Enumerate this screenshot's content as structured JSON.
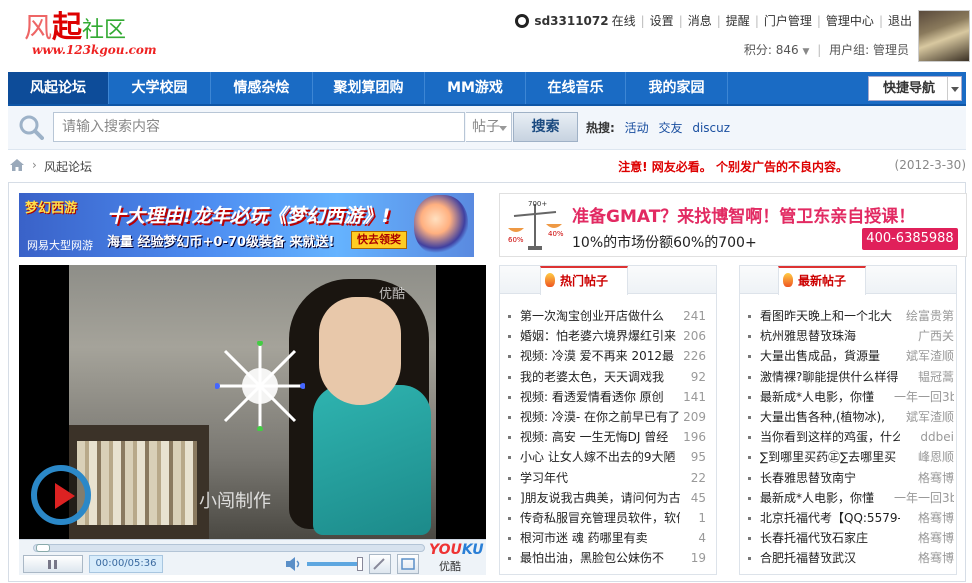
{
  "logo": {
    "part1": "风",
    "part2": "起",
    "part3": "社区",
    "url_text": "www.123kgou.com"
  },
  "user": {
    "username": "sd3311072",
    "status": "在线",
    "links": [
      "设置",
      "消息",
      "提醒",
      "门户管理",
      "管理中心",
      "退出"
    ],
    "points_label": "积分: 846",
    "group_label": "用户组: 管理员"
  },
  "nav": {
    "items": [
      "风起论坛",
      "大学校园",
      "情感杂烩",
      "聚划算团购",
      "MM游戏",
      "在线音乐",
      "我的家园"
    ],
    "active_index": 0,
    "quick_nav": "快捷导航"
  },
  "search": {
    "placeholder": "请输入搜索内容",
    "type_selected": "帖子",
    "button": "搜索",
    "hot_label": "热搜:",
    "hot_links": [
      "活动",
      "交友",
      "discuz"
    ]
  },
  "breadcrumb": {
    "current": "风起论坛",
    "notice": "注意! 网友必看。 个别发广告的不良内容。",
    "date": "(2012-3-30)"
  },
  "ad_left": {
    "game_logo": "梦幻西游",
    "game_sub": "网易大型网游",
    "headline": "十大理由!龙年必玩《梦幻西游》!",
    "subline": "海量 经验梦幻币+0-70级装备 来就送!",
    "button": "快去领奖"
  },
  "ad_right": {
    "headline": "准备GMAT？来找博智啊！管卫东亲自授课！",
    "subline": "10%的市场份额60%的700+",
    "phone": "400-6385988",
    "scale_top": "700+",
    "scale_left": "60%",
    "scale_right": "40%"
  },
  "video": {
    "watermark_top": "优酷",
    "watermark_bottom": "小闯制作",
    "time": "00:00/05:36",
    "progress": 0.0,
    "volume": 0.8,
    "brand_a": "YOU",
    "brand_b": "KU",
    "brand_cn": "优酷"
  },
  "hot_posts": {
    "title": "热门帖子",
    "items": [
      {
        "t": "第一次淘宝创业开店做什么",
        "n": "241"
      },
      {
        "t": "婚姻：怕老婆六境界爆红引来",
        "n": "206"
      },
      {
        "t": "视频: 冷漠 爱不再来 2012最",
        "n": "226"
      },
      {
        "t": "我的老婆太色，天天调戏我",
        "n": "92"
      },
      {
        "t": "视频: 看透爱情看透你 原创",
        "n": "141"
      },
      {
        "t": "视频: 冷漠- 在你之前早已有了",
        "n": "209"
      },
      {
        "t": "视频: 高安 一生无悔DJ 曾经",
        "n": "196"
      },
      {
        "t": "小心 让女人嫁不出去的9大陋",
        "n": "95"
      },
      {
        "t": "学习年代",
        "n": "22"
      },
      {
        "t": "]朋友说我古典美，请问何为古",
        "n": "45"
      },
      {
        "t": "传奇私服冒充管理员软件，软件",
        "n": "1"
      },
      {
        "t": "根河市迷 魂 药哪里有卖",
        "n": "4"
      },
      {
        "t": "最怕出油，黑脸包公妹伤不",
        "n": "19"
      }
    ]
  },
  "new_posts": {
    "title": "最新帖子",
    "items": [
      {
        "t": "看图昨天晚上和一个北大",
        "n": "绘富贵第"
      },
      {
        "t": "杭州雅思替攷珠海",
        "n": "广西关"
      },
      {
        "t": "大量出售成品，貨源量",
        "n": "斌军渣顺"
      },
      {
        "t": "激情裸?聊能提供什么样得",
        "n": "韫冠蒿"
      },
      {
        "t": "最新成*人电影，你懂",
        "n": "一年一回3b"
      },
      {
        "t": "大量出售各种,(植物冰),",
        "n": "斌军渣顺"
      },
      {
        "t": "当你看到这样的鸡蛋，什么",
        "n": "ddbei"
      },
      {
        "t": "∑到哪里买药㊣∑去哪里买",
        "n": "峰恩顺"
      },
      {
        "t": "长春雅思替攷南宁",
        "n": "格骞博"
      },
      {
        "t": "最新成*人电影，你懂",
        "n": "一年一回3b"
      },
      {
        "t": "北京托福代考【QQ:5579-",
        "n": "格骞博"
      },
      {
        "t": "长春托福代攷石家庄",
        "n": "格骞博"
      },
      {
        "t": "合肥托福替攷武汉",
        "n": "格骞博"
      }
    ]
  }
}
